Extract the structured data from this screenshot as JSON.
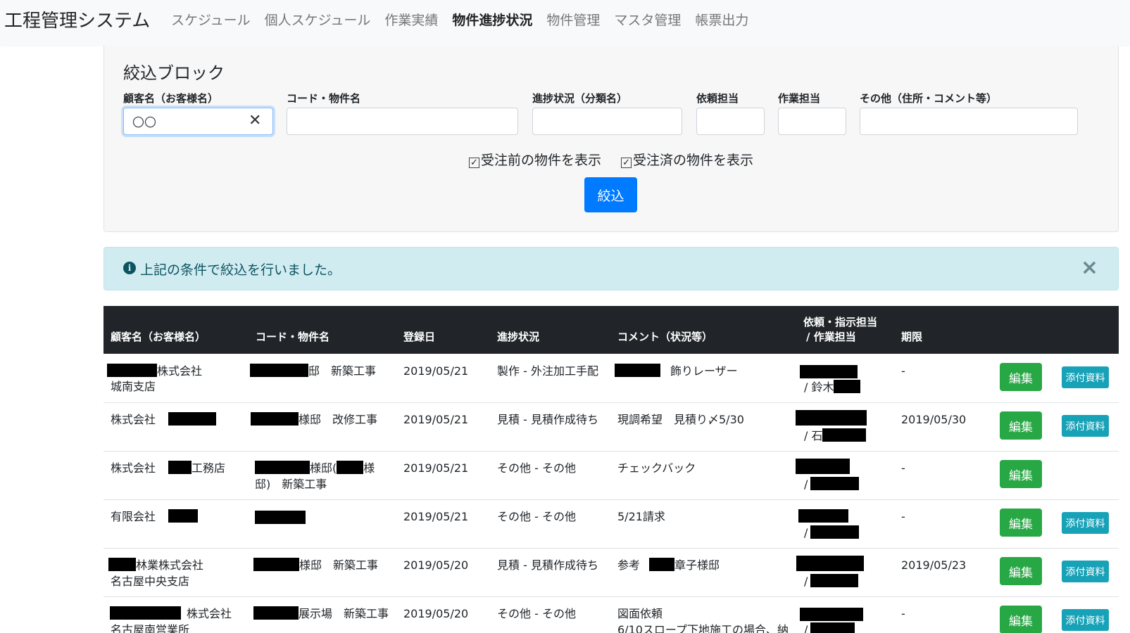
{
  "nav": {
    "brand": "工程管理システム",
    "items": [
      {
        "label": "スケジュール",
        "active": false
      },
      {
        "label": "個人スケジュール",
        "active": false
      },
      {
        "label": "作業実績",
        "active": false
      },
      {
        "label": "物件進捗状況",
        "active": true
      },
      {
        "label": "物件管理",
        "active": false
      },
      {
        "label": "マスタ管理",
        "active": false
      },
      {
        "label": "帳票出力",
        "active": false
      }
    ]
  },
  "filter": {
    "title": "絞込ブロック",
    "fields": {
      "customer": {
        "label": "顧客名（お客様名）",
        "value": "〇〇"
      },
      "code": {
        "label": "コード・物件名",
        "value": ""
      },
      "progress": {
        "label": "進捗状況（分類名）",
        "value": ""
      },
      "requester": {
        "label": "依頼担当",
        "value": ""
      },
      "worker": {
        "label": "作業担当",
        "value": ""
      },
      "other": {
        "label": "その他（住所・コメント等）",
        "value": ""
      }
    },
    "check_before": "受注前の物件を表示",
    "check_after": "受注済の物件を表示",
    "submit_label": "絞込"
  },
  "alert": {
    "message": "上記の条件で絞込を行いました。"
  },
  "table": {
    "headers": {
      "customer": "顧客名（お客様名）",
      "code": "コード・物件名",
      "date": "登録日",
      "progress": "進捗状況",
      "comment": "コメント（状況等）",
      "staff_line1": "依頼・指示担当",
      "staff_line2": "/ 作業担当",
      "deadline": "期限"
    },
    "edit_label": "編集",
    "attach_label": "添付資料",
    "rows": [
      {
        "customer_a": "株式会社",
        "customer_b": "城南支店",
        "code_a": "邸　新築工事",
        "code_b": "",
        "date": "2019/05/21",
        "progress": "製作 - 外注加工手配",
        "comment_a": "飾りレーザー",
        "comment_b": "",
        "staff_b": "/ 鈴木",
        "deadline": "-",
        "has_attach": true
      },
      {
        "customer_a": "株式会社",
        "customer_b": "",
        "code_a": "様邸　改修工事",
        "code_b": "",
        "date": "2019/05/21",
        "progress": "見積 - 見積作成待ち",
        "comment_a": "現調希望　見積り〆5/30",
        "comment_b": "",
        "staff_b": "/ 石",
        "deadline": "2019/05/30",
        "has_attach": true
      },
      {
        "customer_a": "株式会社",
        "customer_b": "工務店",
        "code_a": "様邸(",
        "code_a2": "様",
        "code_b": "邸)　新築工事",
        "date": "2019/05/21",
        "progress": "その他 - その他",
        "comment_a": "チェックバック",
        "comment_b": "",
        "staff_b": "/",
        "deadline": "-",
        "has_attach": false
      },
      {
        "customer_a": "有限会社",
        "customer_b": "",
        "code_a": "",
        "code_b": "",
        "date": "2019/05/21",
        "progress": "その他 - その他",
        "comment_a": "5/21請求",
        "comment_b": "",
        "staff_b": "/",
        "deadline": "-",
        "has_attach": true
      },
      {
        "customer_a": "林業株式会社",
        "customer_b": "名古屋中央支店",
        "code_a": "様邸　新築工事",
        "code_b": "",
        "date": "2019/05/20",
        "progress": "見積 - 見積作成待ち",
        "comment_a": "参考",
        "comment_a2": "章子様邸",
        "comment_b": "",
        "staff_b": "/",
        "deadline": "2019/05/23",
        "has_attach": true
      },
      {
        "customer_a": "株式会社",
        "customer_b": "名古屋南営業所",
        "code_a": "展示場　新築工事",
        "code_b": "",
        "date": "2019/05/20",
        "progress": "その他 - その他",
        "comment_a": "図面依頼",
        "comment_b": "6/10スロープ下地施工の場合、納",
        "staff_b": "/",
        "deadline": "-",
        "has_attach": true
      }
    ]
  }
}
